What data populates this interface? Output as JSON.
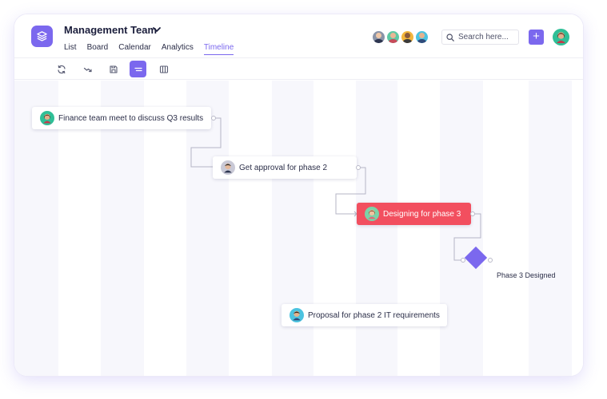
{
  "header": {
    "team_name": "Management Team",
    "tabs": [
      {
        "label": "List",
        "active": false
      },
      {
        "label": "Board",
        "active": false
      },
      {
        "label": "Calendar",
        "active": false
      },
      {
        "label": "Analytics",
        "active": false
      },
      {
        "label": "Timeline",
        "active": true
      }
    ],
    "search_placeholder": "Search here...",
    "add_label": "+",
    "accent_color": "#7b68ee"
  },
  "team_avatars": [
    "avatar-1",
    "avatar-2",
    "avatar-3",
    "avatar-4"
  ],
  "toolbar": {
    "buttons": [
      "refresh-icon",
      "trend-icon",
      "save-icon",
      "align-icon",
      "columns-icon"
    ],
    "active": "align-icon"
  },
  "timeline": {
    "tasks": [
      {
        "label": "Finance team meet to discuss Q3 results",
        "highlight": false
      },
      {
        "label": "Get approval for phase 2",
        "highlight": false
      },
      {
        "label": "Designing for phase 3",
        "highlight": true,
        "color": "#f24f5f"
      },
      {
        "label": "Proposal for phase 2 IT requirements",
        "highlight": false
      }
    ],
    "milestone": {
      "label": "Phase 3 Designed",
      "color": "#7b68ee"
    }
  }
}
